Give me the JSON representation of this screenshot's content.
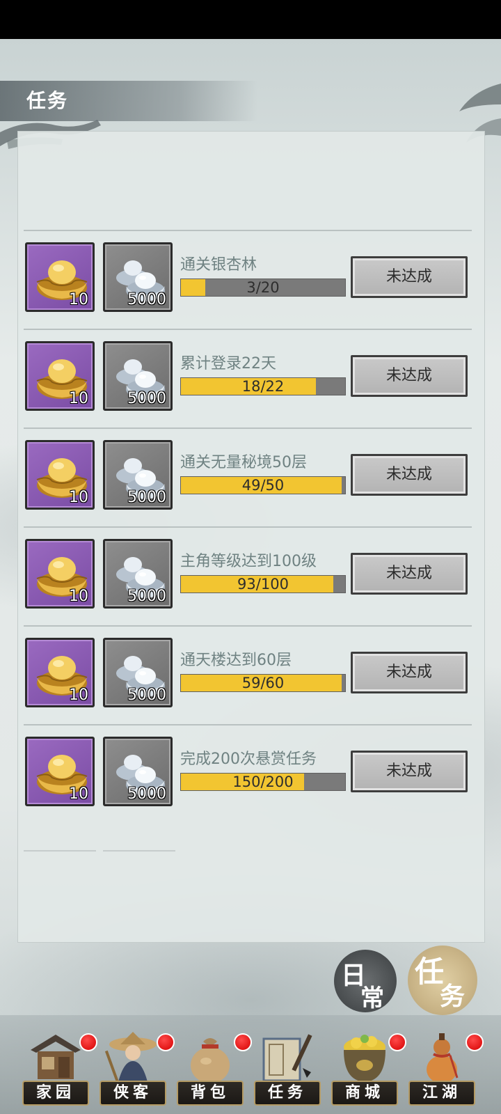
{
  "header": {
    "title": "任务"
  },
  "colors": {
    "progress_fill": "#f2c531",
    "progress_track": "#7a7a7a",
    "gold_frame": "#8a5bb5",
    "silver_frame": "#7d7d7d",
    "badge": "#e00000"
  },
  "tasks": [
    {
      "name": "通关银杏林",
      "progress_text": "3/20",
      "progress": 0.15,
      "gold": "10",
      "silver": "5000",
      "status": "未达成"
    },
    {
      "name": "累计登录22天",
      "progress_text": "18/22",
      "progress": 0.82,
      "gold": "10",
      "silver": "5000",
      "status": "未达成"
    },
    {
      "name": "通关无量秘境50层",
      "progress_text": "49/50",
      "progress": 0.98,
      "gold": "10",
      "silver": "5000",
      "status": "未达成"
    },
    {
      "name": "主角等级达到100级",
      "progress_text": "93/100",
      "progress": 0.93,
      "gold": "10",
      "silver": "5000",
      "status": "未达成"
    },
    {
      "name": "通天楼达到60层",
      "progress_text": "59/60",
      "progress": 0.98,
      "gold": "10",
      "silver": "5000",
      "status": "未达成"
    },
    {
      "name": "完成200次悬赏任务",
      "progress_text": "150/200",
      "progress": 0.75,
      "gold": "10",
      "silver": "5000",
      "status": "未达成"
    }
  ],
  "side_tabs": {
    "daily": {
      "char1": "日",
      "char2": "常"
    },
    "task": {
      "char1": "任",
      "char2": "务"
    }
  },
  "nav": [
    {
      "label": "家园",
      "badge": true,
      "icon": "house-icon"
    },
    {
      "label": "侠客",
      "badge": true,
      "icon": "swordsman-icon"
    },
    {
      "label": "背包",
      "badge": true,
      "icon": "bag-icon"
    },
    {
      "label": "任务",
      "badge": false,
      "icon": "scroll-icon"
    },
    {
      "label": "商城",
      "badge": true,
      "icon": "treasure-pot-icon"
    },
    {
      "label": "江湖",
      "badge": true,
      "icon": "gourd-icon"
    }
  ]
}
